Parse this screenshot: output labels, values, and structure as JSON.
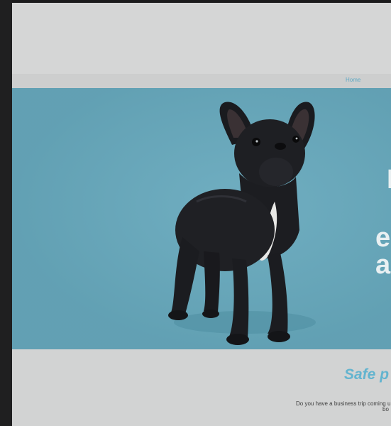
{
  "nav": {
    "home_label": "Home"
  },
  "hero": {
    "glyphs": [
      "I",
      "e",
      "a"
    ],
    "image_alt": "black-french-bulldog-puppy",
    "background_color": "#67a9bd"
  },
  "section": {
    "title": "Safe p",
    "text_line1": "Do you have a business trip coming u",
    "text_line2": "bo",
    "accent_color": "#63b4cf"
  }
}
